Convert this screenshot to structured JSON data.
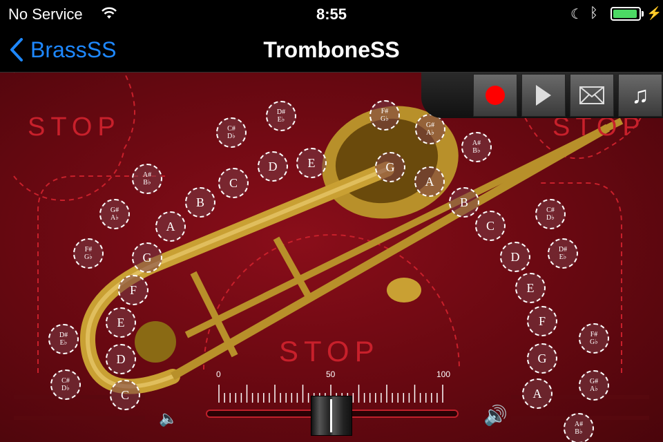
{
  "status_bar": {
    "carrier": "No Service",
    "time": "8:55",
    "battery_level": 0.95,
    "icons": [
      "wifi-icon",
      "moon-icon",
      "bluetooth-icon",
      "battery-icon",
      "charging-icon"
    ]
  },
  "nav_bar": {
    "back_label": "BrassSS",
    "title": "TromboneSS"
  },
  "toolbar": {
    "buttons": [
      {
        "name": "record",
        "icon": "record-icon"
      },
      {
        "name": "play",
        "icon": "play-icon"
      },
      {
        "name": "email",
        "icon": "mail-icon"
      },
      {
        "name": "music",
        "icon": "music-notes-icon"
      }
    ]
  },
  "stop_labels": [
    "STOP",
    "STOP",
    "STOP"
  ],
  "notes_left": [
    {
      "top": "C#",
      "bottom": "D♭"
    },
    {
      "top": "D#",
      "bottom": "E♭"
    },
    {
      "top": "A#",
      "bottom": "B♭"
    },
    {
      "label": "C"
    },
    {
      "label": "D"
    },
    {
      "label": "E"
    },
    {
      "label": "B"
    },
    {
      "top": "G#",
      "bottom": "A♭"
    },
    {
      "label": "A"
    },
    {
      "top": "F#",
      "bottom": "G♭"
    },
    {
      "label": "G"
    },
    {
      "label": "F"
    },
    {
      "label": "E"
    },
    {
      "top": "D#",
      "bottom": "E♭"
    },
    {
      "label": "D"
    },
    {
      "top": "C#",
      "bottom": "D♭"
    },
    {
      "label": "C"
    }
  ],
  "notes_right": [
    {
      "top": "F#",
      "bottom": "G♭"
    },
    {
      "top": "G#",
      "bottom": "A♭"
    },
    {
      "label": "G"
    },
    {
      "top": "A#",
      "bottom": "B♭"
    },
    {
      "label": "A"
    },
    {
      "label": "B"
    },
    {
      "top": "C#",
      "bottom": "D♭"
    },
    {
      "label": "C"
    },
    {
      "top": "D#",
      "bottom": "E♭"
    },
    {
      "label": "D"
    },
    {
      "label": "E"
    },
    {
      "label": "F"
    },
    {
      "top": "F#",
      "bottom": "G♭"
    },
    {
      "label": "G"
    },
    {
      "top": "G#",
      "bottom": "A♭"
    },
    {
      "label": "A"
    },
    {
      "top": "A#",
      "bottom": "B♭"
    }
  ],
  "volume": {
    "min_label": "0",
    "mid_label": "50",
    "max_label": "100",
    "value_percent": 50
  },
  "colors": {
    "accent": "#1e88ff",
    "record": "#ff0000",
    "stop": "#c8202b",
    "background": "#6d0912"
  }
}
